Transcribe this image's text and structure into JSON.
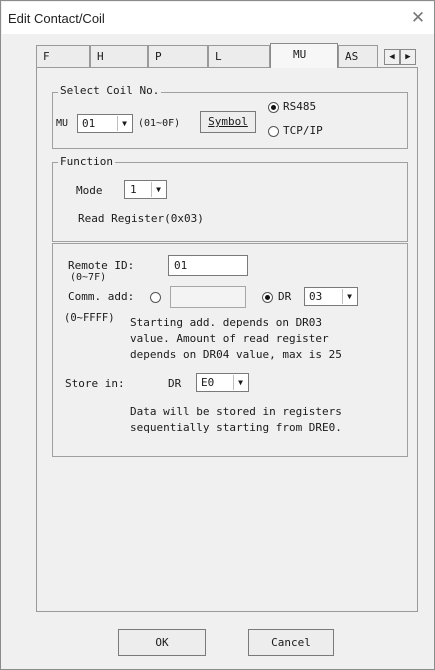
{
  "window": {
    "title": "Edit Contact/Coil"
  },
  "tabs": [
    {
      "label": "F"
    },
    {
      "label": "H"
    },
    {
      "label": "P"
    },
    {
      "label": "L"
    },
    {
      "label": "MU"
    },
    {
      "label": "AS"
    }
  ],
  "tab_scroll": {
    "left": "◀",
    "right": "▶"
  },
  "select_coil": {
    "legend": "Select Coil No.",
    "prefix": "MU",
    "value": "01",
    "range": "(01~0F)",
    "symbol_button": "Symbol",
    "radio_rs485": "RS485",
    "radio_tcpip": "TCP/IP"
  },
  "function": {
    "legend": "Function",
    "mode_label": "Mode",
    "mode_value": "1",
    "description": "Read Register(0x03)"
  },
  "params": {
    "remote_id_label": "Remote ID:",
    "remote_id_range": "(0~7F)",
    "remote_id_value": "01",
    "comm_add_label": "Comm. add:",
    "comm_add_range": "(0~FFFF)",
    "dr_label": "DR",
    "dr_value": "03",
    "note_line1": "Starting add. depends on DR03",
    "note_line2": "value. Amount of read register",
    "note_line3": "depends on DR04 value, max is 25",
    "store_label": "Store in:",
    "store_dr_label": "DR",
    "store_value": "E0",
    "store_note1": "Data will be stored in registers",
    "store_note2": "sequentially starting from DRE0."
  },
  "buttons": {
    "ok": "OK",
    "cancel": "Cancel"
  }
}
